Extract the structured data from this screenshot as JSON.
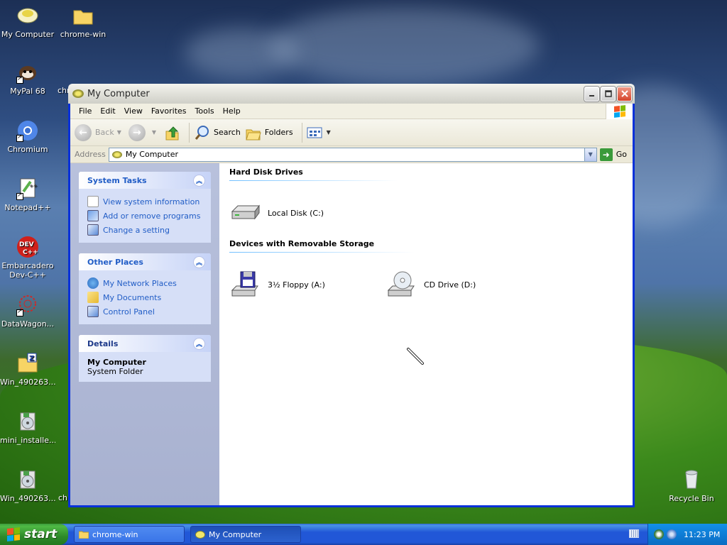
{
  "desktop": {
    "icons": [
      {
        "label": "My Computer"
      },
      {
        "label": "chrome-win"
      },
      {
        "label": "MyPal 68"
      },
      {
        "label": "chr"
      },
      {
        "label": "Chromium"
      },
      {
        "label": "Notepad++"
      },
      {
        "label": "Embarcadero Dev-C++"
      },
      {
        "label": "DataWagon..."
      },
      {
        "label": "Win_490263..."
      },
      {
        "label": "mini_installe..."
      },
      {
        "label": "Win_490263..."
      },
      {
        "label": "ch"
      },
      {
        "label": "Recycle Bin"
      }
    ]
  },
  "window": {
    "title": "My Computer",
    "menu": [
      "File",
      "Edit",
      "View",
      "Favorites",
      "Tools",
      "Help"
    ],
    "toolbar": {
      "back": "Back",
      "search": "Search",
      "folders": "Folders"
    },
    "address": {
      "label": "Address",
      "value": "My Computer",
      "go": "Go"
    },
    "left_panels": {
      "system_tasks": {
        "title": "System Tasks",
        "links": [
          "View system information",
          "Add or remove programs",
          "Change a setting"
        ]
      },
      "other_places": {
        "title": "Other Places",
        "links": [
          "My Network Places",
          "My Documents",
          "Control Panel"
        ]
      },
      "details": {
        "title": "Details",
        "name": "My Computer",
        "type": "System Folder"
      }
    },
    "groups": [
      {
        "title": "Hard Disk Drives",
        "items": [
          "Local Disk (C:)"
        ]
      },
      {
        "title": "Devices with Removable Storage",
        "items": [
          "3½ Floppy (A:)",
          "CD Drive (D:)"
        ]
      }
    ]
  },
  "taskbar": {
    "start": "start",
    "tasks": [
      "chrome-win",
      "My Computer"
    ],
    "clock": "11:23 PM"
  }
}
